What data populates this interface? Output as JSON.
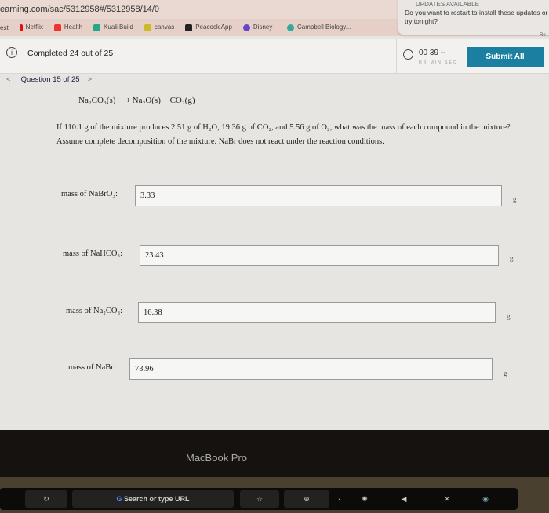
{
  "browser": {
    "url": "earning.com/sac/5312958#/5312958/14/0",
    "bookmarks": [
      "est",
      "Netflix",
      "Health",
      "Kuali Build",
      "canvas",
      "Peacock App",
      "Disney+",
      "Campbell Biology..."
    ],
    "reader_label": "Re"
  },
  "notification": {
    "heading": "UPDATES AVAILABLE",
    "message": "Do you want to restart to install these updates or try tonight?"
  },
  "header": {
    "completed": "Completed 24 out of 25",
    "timer_value": "00 39 --",
    "timer_labels": "HR MIN SEC",
    "submit_label": "Submit All",
    "accent": "#1a7fa0"
  },
  "nav": {
    "prev": "<",
    "question": "Question 15 of 25",
    "next": ">"
  },
  "question": {
    "equation": "Na₂CO₃(s) ⟶ Na₂O(s) + CO₂(g)",
    "text": "If 110.1 g of the mixture produces 2.51 g of H₂O, 19.36 g of CO₂, and 5.56 g of O₂, what was the mass of each compound in the mixture? Assume complete decomposition of the mixture. NaBr does not react under the reaction conditions."
  },
  "answers": [
    {
      "label": "mass of NaBrO₃:",
      "value": "3.33",
      "unit": "g"
    },
    {
      "label": "mass of NaHCO₃:",
      "value": "23.43",
      "unit": "g"
    },
    {
      "label": "mass of Na₂CO₃:",
      "value": "16.38",
      "unit": "g"
    },
    {
      "label": "mass of NaBr:",
      "value": "73.96",
      "unit": "g"
    }
  ],
  "laptop": {
    "brand": "MacBook Pro",
    "touchbar_search": "Search or type URL"
  }
}
